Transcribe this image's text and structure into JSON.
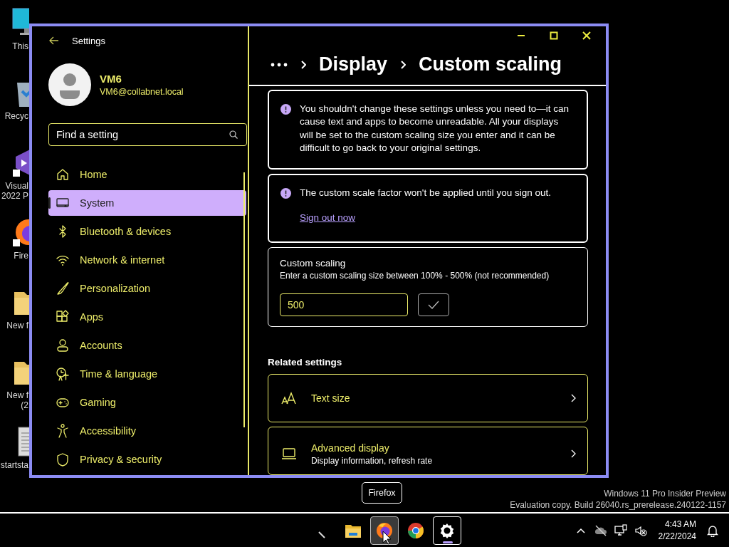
{
  "desktop_icons": [
    {
      "kind": "pc",
      "lines": [
        "This"
      ]
    },
    {
      "kind": "bin",
      "lines": [
        "Recyc"
      ]
    },
    {
      "kind": "vs",
      "lines": [
        "Visual",
        "2022 P"
      ]
    },
    {
      "kind": "firefox",
      "lines": [
        "Fire"
      ]
    },
    {
      "kind": "folder",
      "lines": [
        "New f"
      ]
    },
    {
      "kind": "folder",
      "lines": [
        "New f",
        "(2"
      ]
    },
    {
      "kind": "file",
      "lines": [
        "startsta"
      ]
    }
  ],
  "window": {
    "title": "Settings"
  },
  "user": {
    "name": "VM6",
    "email": "VM6@collabnet.local"
  },
  "search": {
    "placeholder": "Find a setting"
  },
  "nav": [
    {
      "kind": "home",
      "label": "Home",
      "selected": false
    },
    {
      "kind": "system",
      "label": "System",
      "selected": true
    },
    {
      "kind": "bluetooth",
      "label": "Bluetooth & devices",
      "selected": false
    },
    {
      "kind": "network",
      "label": "Network & internet",
      "selected": false
    },
    {
      "kind": "brush",
      "label": "Personalization",
      "selected": false
    },
    {
      "kind": "apps",
      "label": "Apps",
      "selected": false
    },
    {
      "kind": "accounts",
      "label": "Accounts",
      "selected": false
    },
    {
      "kind": "time",
      "label": "Time & language",
      "selected": false
    },
    {
      "kind": "gaming",
      "label": "Gaming",
      "selected": false
    },
    {
      "kind": "accessibility",
      "label": "Accessibility",
      "selected": false
    },
    {
      "kind": "shield",
      "label": "Privacy & security",
      "selected": false
    }
  ],
  "breadcrumb": [
    "Display",
    "Custom scaling"
  ],
  "notices": [
    {
      "text": "You shouldn't change these settings unless you need to—it can cause text and apps to become unreadable. All your displays will be set to the custom scaling size you enter and it can be difficult to go back to your original settings."
    },
    {
      "text": "The custom scale factor won't be applied until you sign out.",
      "link": "Sign out now"
    }
  ],
  "custom_scaling": {
    "title": "Custom scaling",
    "description": "Enter a custom scaling size between 100% - 500% (not recommended)",
    "value": "500"
  },
  "related": {
    "heading": "Related settings",
    "items": [
      {
        "kind": "text-size",
        "title": "Text size"
      },
      {
        "kind": "display",
        "title": "Advanced display",
        "subtitle": "Display information, refresh rate"
      }
    ]
  },
  "tooltip": "Firefox",
  "build_info": [
    "Windows 11 Pro Insider Preview",
    "Evaluation copy. Build 26040.rs_prerelease.240122-1157"
  ],
  "taskbar": {
    "apps": [
      {
        "kind": "pen",
        "selected": false,
        "hovered": false
      },
      {
        "kind": "explorer",
        "selected": false,
        "hovered": false
      },
      {
        "kind": "firefox",
        "selected": false,
        "hovered": true
      },
      {
        "kind": "chrome",
        "selected": false,
        "hovered": false
      },
      {
        "kind": "settings",
        "selected": true,
        "hovered": false
      }
    ],
    "time": "4:43 AM",
    "date": "2/22/2024"
  }
}
